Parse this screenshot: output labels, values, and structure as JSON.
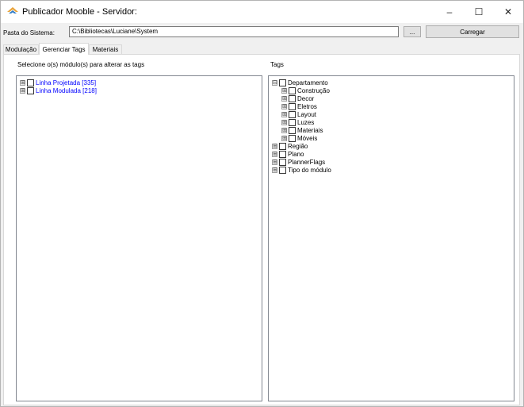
{
  "window": {
    "title": "Publicador Mooble - Servidor:",
    "minimize": "–",
    "maximize": "☐",
    "close": "✕"
  },
  "toolbar": {
    "folder_label": "Pasta do Sistema:",
    "folder_value": "C:\\Bibliotecas\\Luciane\\System",
    "browse_label": "...",
    "load_label": "Carregar"
  },
  "tabs": [
    {
      "label": "Modulação"
    },
    {
      "label": "Gerenciar Tags"
    },
    {
      "label": "Materiais"
    }
  ],
  "left_panel": {
    "heading": "Selecione o(s) módulo(s) para alterar as tags",
    "items": [
      {
        "label": "Linha Projetada [335]"
      },
      {
        "label": "Linha Modulada [218]"
      }
    ]
  },
  "right_panel": {
    "heading": "Tags",
    "root": {
      "label": "Departamento"
    },
    "children": [
      {
        "label": "Construção"
      },
      {
        "label": "Decor"
      },
      {
        "label": "Eletros"
      },
      {
        "label": "Layout"
      },
      {
        "label": "Luzes"
      },
      {
        "label": "Materiais"
      },
      {
        "label": "Móveis"
      }
    ],
    "others": [
      {
        "label": "Região"
      },
      {
        "label": "Plano"
      },
      {
        "label": "PlannerFlags"
      },
      {
        "label": "Tipo do módulo"
      }
    ]
  },
  "colors": {
    "accent_link": "#0000ff",
    "icon_primary": "#e8a33a",
    "icon_secondary": "#2e7bc7"
  },
  "icons": {
    "app": "mooble-logo-icon",
    "expander_collapsed": "⊞",
    "expander_expanded": "⊟"
  }
}
